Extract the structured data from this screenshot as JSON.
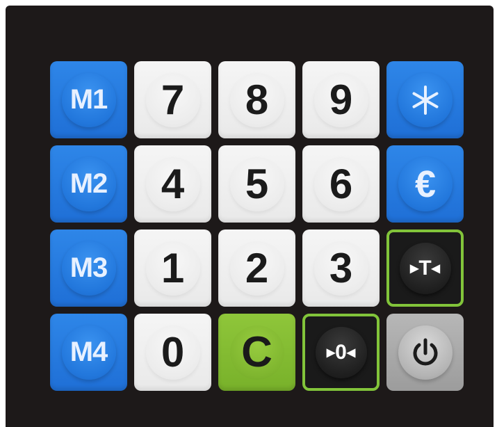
{
  "keypad": {
    "rows": [
      [
        {
          "label": "M1",
          "icon": "",
          "style": "blue"
        },
        {
          "label": "7",
          "icon": "",
          "style": "white"
        },
        {
          "label": "8",
          "icon": "",
          "style": "white"
        },
        {
          "label": "9",
          "icon": "",
          "style": "white"
        },
        {
          "label": "∗",
          "icon": "asterisk-icon",
          "style": "blue"
        }
      ],
      [
        {
          "label": "M2",
          "icon": "",
          "style": "blue"
        },
        {
          "label": "4",
          "icon": "",
          "style": "white"
        },
        {
          "label": "5",
          "icon": "",
          "style": "white"
        },
        {
          "label": "6",
          "icon": "",
          "style": "white"
        },
        {
          "label": "€",
          "icon": "euro-icon",
          "style": "blue"
        }
      ],
      [
        {
          "label": "M3",
          "icon": "",
          "style": "blue"
        },
        {
          "label": "1",
          "icon": "",
          "style": "white"
        },
        {
          "label": "2",
          "icon": "",
          "style": "white"
        },
        {
          "label": "3",
          "icon": "",
          "style": "white"
        },
        {
          "label": "T",
          "icon": "tare-icon",
          "style": "dark"
        }
      ],
      [
        {
          "label": "M4",
          "icon": "",
          "style": "blue"
        },
        {
          "label": "0",
          "icon": "",
          "style": "white"
        },
        {
          "label": "C",
          "icon": "",
          "style": "green"
        },
        {
          "label": "0",
          "icon": "zero-icon",
          "style": "dark"
        },
        {
          "label": "",
          "icon": "power-icon",
          "style": "grey"
        }
      ]
    ]
  },
  "colors": {
    "panel": "#1d1919",
    "memory_blue": "#2277dc",
    "clear_green": "#7fb62f",
    "outline_green": "#82c43a",
    "number_white": "#ececec"
  }
}
